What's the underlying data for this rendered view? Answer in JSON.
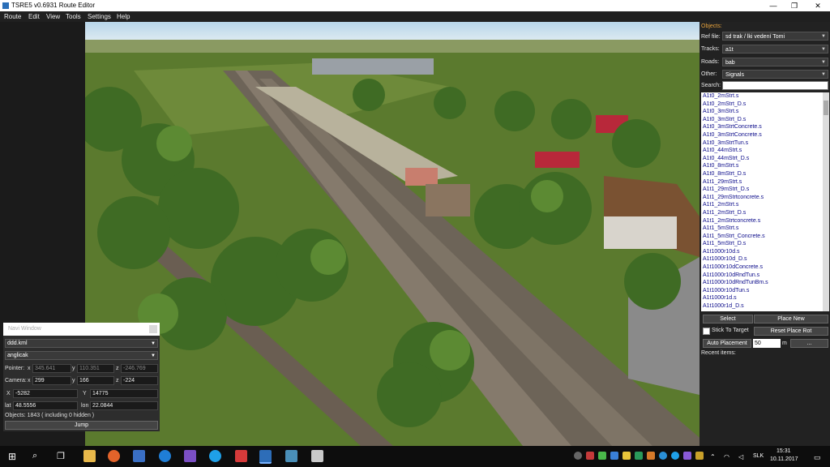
{
  "window": {
    "title": "TSRE5 v0.6931 Route Editor",
    "minimize": "—",
    "maximize": "❐",
    "close": "✕"
  },
  "menu": [
    "Route",
    "Edit",
    "View",
    "Tools",
    "Settings",
    "Help"
  ],
  "panel": {
    "objects_label": "Objects:",
    "ref_file_label": "Ref file:",
    "ref_file_value": "sd trak / lki vedení Tomi",
    "tracks_label": "Tracks:",
    "tracks_value": "a1t",
    "roads_label": "Roads:",
    "roads_value": "bab",
    "other_label": "Other:",
    "other_value": "Signals",
    "search_label": "Search:",
    "items": [
      "A1t0_2mStrt.s",
      "A1t0_2mStrt_D.s",
      "A1t0_3mStrt.s",
      "A1t0_3mStrt_D.s",
      "A1t0_3mStrtConcrete.s",
      "A1t0_3mStrtConcrete.s",
      "A1t0_3mStrtTun.s",
      "A1t0_44mStrt.s",
      "A1t0_44mStrt_D.s",
      "A1t0_8mStrt.s",
      "A1t0_8mStrt_D.s",
      "A1t1_29mStrt.s",
      "A1t1_29mStrt_D.s",
      "A1t1_29mStrtconcrete.s",
      "A1t1_2mStrt.s",
      "A1t1_2mStrt_D.s",
      "A1t1_2mStrtconcrete.s",
      "A1t1_5mStrt.s",
      "A1t1_5mStrt_Concrete.s",
      "A1t1_5mStrt_D.s",
      "A1t1000r10d.s",
      "A1t1000r10d_D.s",
      "A1t1000r10dConcrete.s",
      "A1t1000r10dRndTun.s",
      "A1t1000r10dRndTunBm.s",
      "A1t1000r10dTun.s",
      "A1t1000r1d.s",
      "A1t1000r1d_D.s"
    ],
    "select_btn": "Select",
    "place_new_btn": "Place New",
    "stick_label": "Stick To Target",
    "reset_btn": "Reset Place Rot",
    "auto_btn": "Auto Placement",
    "auto_value": "50",
    "auto_unit": "m",
    "dots_btn": "...",
    "recent_label": "Recent items:"
  },
  "navi": {
    "title": "Navi Window",
    "file": "ddd.kml",
    "lang": "anglicak",
    "pointer_label": "Pointer:",
    "pointer": {
      "x": "345.641",
      "y": "110.351",
      "z": "-246.769"
    },
    "camera_label": "Camera:",
    "camera": {
      "x": "299",
      "y": "166",
      "z": "-224"
    },
    "X_label": "X",
    "X": "-5282",
    "Y_label": "Y",
    "Y": "14775",
    "lat_label": "lat",
    "lat": "48.5556",
    "lon_label": "lon",
    "lon": "22.0844",
    "objects": "Objects: 1843 ( including 0 hidden )",
    "jump": "Jump",
    "axis_x": "x",
    "axis_y": "y",
    "axis_z": "z"
  },
  "taskbar": {
    "lang": "SLK",
    "time": "15:31",
    "date": "10.11.2017"
  },
  "colors": {
    "accent": "#e6a23c",
    "list_text": "#0a0a8a"
  }
}
